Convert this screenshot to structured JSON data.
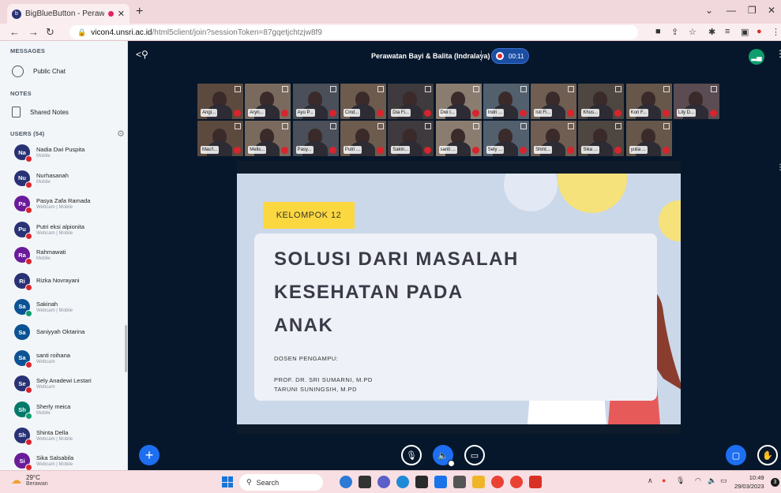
{
  "browser": {
    "tab_title": "BigBlueButton - Perawatan B",
    "tab_favicon": "b",
    "url_host": "vicon4.unsri.ac.id",
    "url_path": "/html5client/join?sessionToken=87gqetjchtzjw8f9"
  },
  "sidebar": {
    "messages_label": "MESSAGES",
    "public_chat": "Public Chat",
    "notes_label": "NOTES",
    "shared_notes": "Shared Notes",
    "users_label": "USERS (54)",
    "users": [
      {
        "initials": "Na",
        "name": "Nadia Dwi Puspita",
        "device": "Mobile",
        "color": "#283274",
        "mic": "muted"
      },
      {
        "initials": "Nu",
        "name": "Nurhasanah",
        "device": "Mobile",
        "color": "#283274",
        "mic": "muted"
      },
      {
        "initials": "Pa",
        "name": "Pasya Zafa Ramada",
        "device": "Webcam | Mobile",
        "color": "#6a1b9a",
        "mic": "muted"
      },
      {
        "initials": "Pu",
        "name": "Putri eksi alpionita",
        "device": "Webcam | Mobile",
        "color": "#283274",
        "mic": "muted"
      },
      {
        "initials": "Ra",
        "name": "Rahmawati",
        "device": "Mobile",
        "color": "#6a1b9a",
        "mic": "muted"
      },
      {
        "initials": "Ri",
        "name": "Rizka Novrayani",
        "device": "",
        "color": "#283274",
        "mic": "muted"
      },
      {
        "initials": "Sa",
        "name": "Sakinah",
        "device": "Webcam | Mobile",
        "color": "#0b5394",
        "mic": "on"
      },
      {
        "initials": "Sa",
        "name": "Saniyyah Oktarina",
        "device": "",
        "color": "#0b5394",
        "mic": "none"
      },
      {
        "initials": "Sa",
        "name": "santi roihana",
        "device": "Webcam",
        "color": "#0b5394",
        "mic": "muted"
      },
      {
        "initials": "Se",
        "name": "Sely Anadewi Lestari",
        "device": "Webcam",
        "color": "#283274",
        "mic": "muted"
      },
      {
        "initials": "Sh",
        "name": "Sherly meica",
        "device": "Mobile",
        "color": "#00796b",
        "mic": "on"
      },
      {
        "initials": "Sh",
        "name": "Shinta Della",
        "device": "Webcam | Mobile",
        "color": "#283274",
        "mic": "muted"
      },
      {
        "initials": "Si",
        "name": "Sika Salsabila",
        "device": "Webcam | Mobile",
        "color": "#6a1b9a",
        "mic": "muted"
      }
    ]
  },
  "main": {
    "meeting_title": "Perawatan Bayi & Balita (Indralaya)",
    "recording_time": "00:11",
    "videos_row1": [
      "Angi...",
      "Aryn...",
      "Ayu P...",
      "Cind...",
      "Dia Fi...",
      "Dwi I...",
      "Indri ...",
      "Isti Fi...",
      "Khus...",
      "Kori F...",
      "Lily D..."
    ],
    "videos_row2": [
      "Mau'l...",
      "Melis...",
      "Pasy...",
      "Putri ...",
      "Sakin...",
      "santi ...",
      "Sely ...",
      "Shint...",
      "Sika ...",
      "yulia ..."
    ],
    "slide": {
      "tag": "KELOMPOK 12",
      "heading_line1": "SOLUSI DARI MASALAH",
      "heading_line2": "KESEHATAN PADA",
      "heading_line3": "ANAK",
      "lecturer_label": "DOSEN PENGAMPU:",
      "lecturer_1": "PROF. DR. SRI SUMARNI, M.PD",
      "lecturer_2": "TARUNI SUNINGSIH, M.PD"
    }
  },
  "taskbar": {
    "temp": "29°C",
    "weather": "Berawan",
    "search": "Search",
    "time": "10:49",
    "date": "29/03/2023",
    "notifications": "3"
  }
}
